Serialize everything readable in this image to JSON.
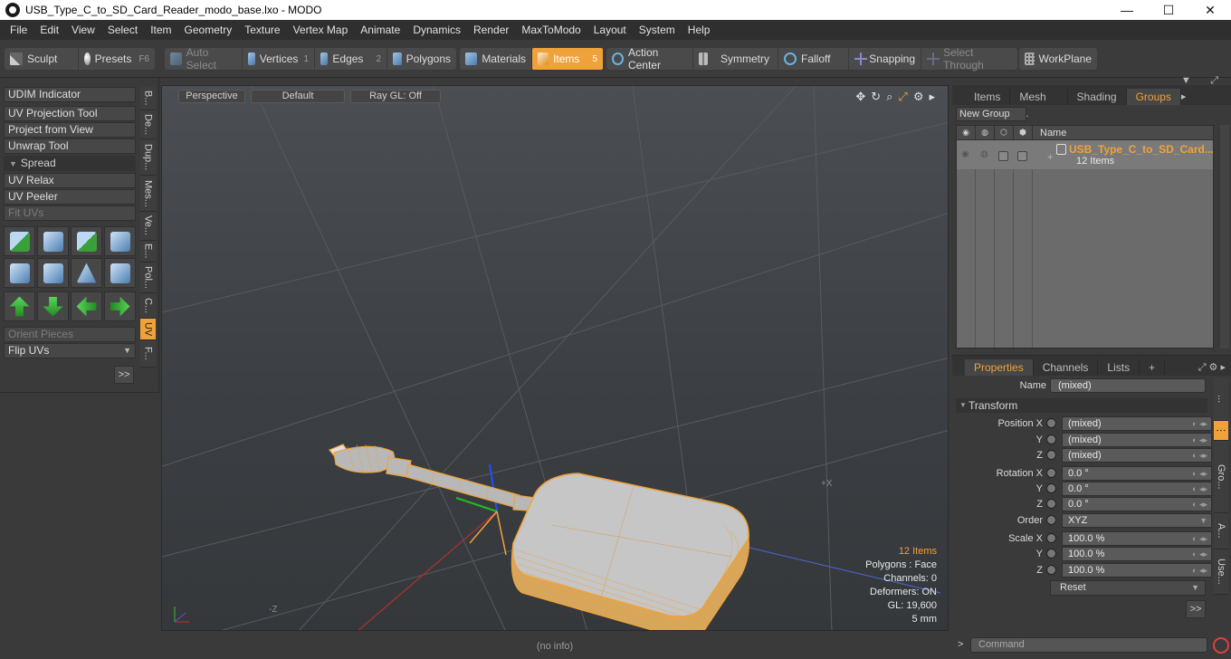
{
  "window": {
    "title": "USB_Type_C_to_SD_Card_Reader_modo_base.lxo - MODO",
    "minimize": "—",
    "maximize": "☐",
    "close": "✕"
  },
  "menu": [
    "File",
    "Edit",
    "View",
    "Select",
    "Item",
    "Geometry",
    "Texture",
    "Vertex Map",
    "Animate",
    "Dynamics",
    "Render",
    "MaxToModo",
    "Layout",
    "System",
    "Help"
  ],
  "toolbar": {
    "sculpt": "Sculpt",
    "presets": "Presets",
    "presets_key": "F6",
    "auto_select": "Auto Select",
    "vertices": "Vertices",
    "vertices_num": "1",
    "edges": "Edges",
    "edges_num": "2",
    "polygons": "Polygons",
    "materials": "Materials",
    "items": "Items",
    "items_num": "5",
    "action_center": "Action Center",
    "symmetry": "Symmetry",
    "falloff": "Falloff",
    "snapping": "Snapping",
    "select_through": "Select Through",
    "workplane": "WorkPlane"
  },
  "left_panel": {
    "udim": "UDIM Indicator",
    "uv_projection": "UV Projection Tool",
    "project_from_view": "Project from View",
    "unwrap": "Unwrap Tool",
    "spread": "Spread",
    "uv_relax": "UV Relax",
    "uv_peeler": "UV Peeler",
    "fit_uvs": "Fit UVs",
    "orient_pieces": "Orient Pieces",
    "flip_uvs": "Flip UVs",
    "more": ">>",
    "vtabs": [
      "B...",
      "De...",
      "Dup...",
      "Mes...",
      "Ve...",
      "E...",
      "Pol...",
      "C...",
      "UV",
      "F..."
    ]
  },
  "viewport": {
    "perspective": "Perspective",
    "default": "Default",
    "raygl": "Ray GL: Off",
    "info": {
      "items": "12 Items",
      "polygons": "Polygons : Face",
      "channels": "Channels: 0",
      "deformers": "Deformers: ON",
      "gl": "GL: 19,600",
      "scale": "5 mm"
    },
    "axis_z": "-Z",
    "axis_x": "+X",
    "status": "(no info)"
  },
  "groups_panel": {
    "tabs": [
      "Items",
      "Mesh ...",
      "Shading",
      "Groups"
    ],
    "active_tab": "Groups",
    "new_group": "New Group",
    "name_header": "Name",
    "group_name": "USB_Type_C_to_SD_Card...",
    "group_count": "12 Items"
  },
  "properties": {
    "tabs": [
      "Properties",
      "Channels",
      "Lists",
      "+"
    ],
    "name_label": "Name",
    "name_value": "(mixed)",
    "transform": "Transform",
    "position_x_label": "Position X",
    "y_label": "Y",
    "z_label": "Z",
    "position_x": "(mixed)",
    "position_y": "(mixed)",
    "position_z": "(mixed)",
    "rotation_x_label": "Rotation X",
    "rotation_x": "0.0 °",
    "rotation_y": "0.0 °",
    "rotation_z": "0.0 °",
    "order_label": "Order",
    "order": "XYZ",
    "scale_x_label": "Scale X",
    "scale_x": "100.0 %",
    "scale_y": "100.0 %",
    "scale_z": "100.0 %",
    "reset": "Reset",
    "more": ">>",
    "vtabs": [
      "...",
      "Gro...",
      "A...",
      "Use..."
    ]
  },
  "command": {
    "placeholder": "Command"
  },
  "colors": {
    "accent": "#f0a23a",
    "panel": "#3a3a3a"
  }
}
